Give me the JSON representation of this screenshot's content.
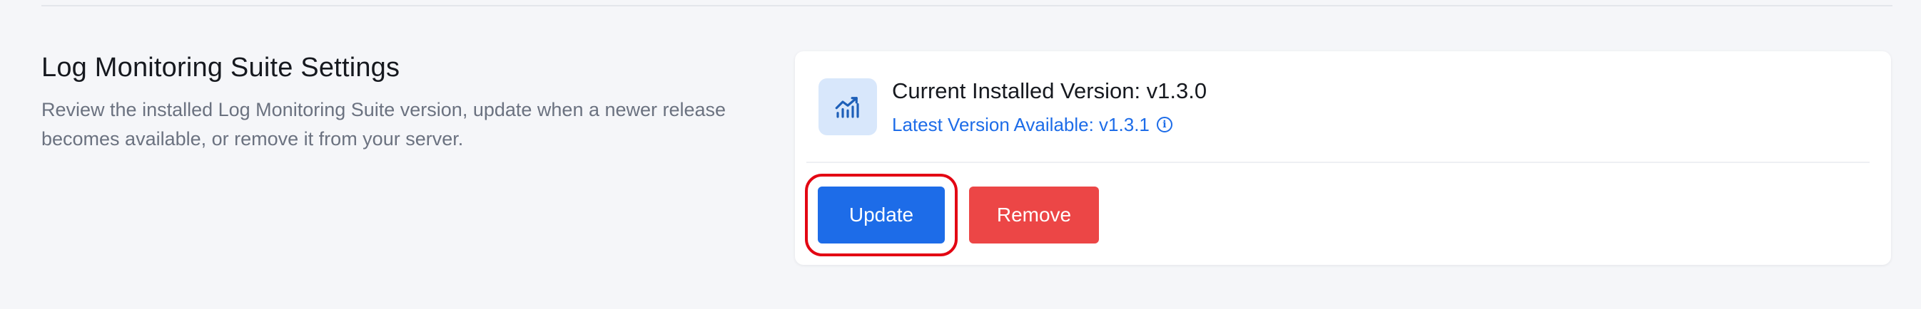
{
  "section": {
    "title": "Log Monitoring Suite Settings",
    "description": "Review the installed Log Monitoring Suite version, update when a newer release becomes available, or remove it from your server."
  },
  "plugin": {
    "icon": "chart-trend-icon",
    "current_version_text": "Current Installed Version: v1.3.0",
    "latest_version_text": "Latest Version Available: v1.3.1",
    "latest_info_icon": "info-icon"
  },
  "actions": {
    "update_label": "Update",
    "remove_label": "Remove"
  },
  "colors": {
    "primary": "#1d6ce8",
    "danger": "#ec4646",
    "highlight": "#e30613",
    "icon_bg": "#d8e7fb"
  }
}
